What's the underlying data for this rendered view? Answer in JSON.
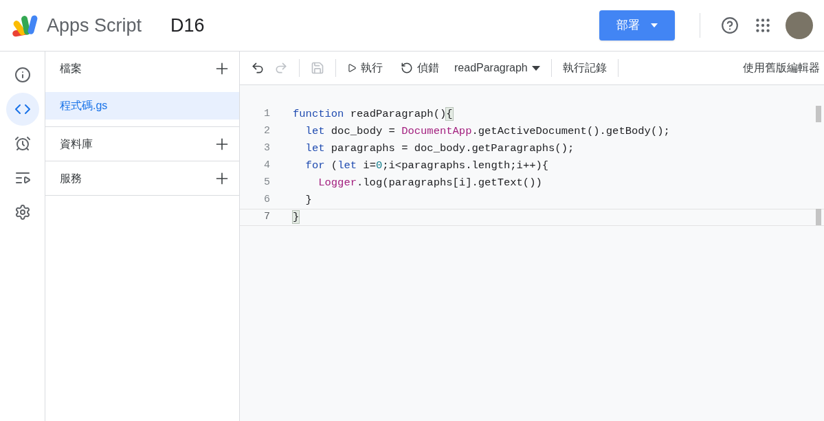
{
  "header": {
    "product": "Apps Script",
    "project": "D16",
    "deploy_button": "部署"
  },
  "rail": [
    {
      "kind": "info",
      "selected": false
    },
    {
      "kind": "code",
      "selected": true
    },
    {
      "kind": "triggers",
      "selected": false
    },
    {
      "kind": "executions",
      "selected": false
    },
    {
      "kind": "settings",
      "selected": false
    }
  ],
  "sections": [
    {
      "title": "檔案",
      "files": [
        {
          "name": "程式碼.gs",
          "selected": true
        }
      ]
    },
    {
      "title": "資料庫"
    },
    {
      "title": "服務"
    }
  ],
  "toolbar": {
    "undo_disabled": false,
    "redo_disabled": true,
    "save_disabled": true,
    "run": "執行",
    "debug": "偵錯",
    "function": "readParagraph",
    "log": "執行記錄",
    "old_editor": "使用舊版編輯器"
  },
  "code": [
    {
      "number": "1",
      "current": false,
      "tokens": [
        {
          "text": "function",
          "kind": "keyword"
        },
        {
          "text": " readParagraph()",
          "kind": "plain"
        },
        {
          "text": "{",
          "kind": "bracket"
        }
      ]
    },
    {
      "number": "2",
      "current": false,
      "tokens": [
        {
          "text": "  let",
          "kind": "keyword"
        },
        {
          "text": " doc_body = ",
          "kind": "plain"
        },
        {
          "text": "DocumentApp",
          "kind": "class"
        },
        {
          "text": ".getActiveDocument().getBody();",
          "kind": "plain"
        }
      ]
    },
    {
      "number": "3",
      "current": false,
      "tokens": [
        {
          "text": "  let",
          "kind": "keyword"
        },
        {
          "text": " paragraphs = doc_body.getParagraphs();",
          "kind": "plain"
        }
      ]
    },
    {
      "number": "4",
      "current": false,
      "tokens": [
        {
          "text": "  for",
          "kind": "keyword"
        },
        {
          "text": " (",
          "kind": "plain"
        },
        {
          "text": "let",
          "kind": "keyword"
        },
        {
          "text": " i=",
          "kind": "plain"
        },
        {
          "text": "0",
          "kind": "number"
        },
        {
          "text": ";i<paragraphs.length;i++){",
          "kind": "plain"
        }
      ]
    },
    {
      "number": "5",
      "current": false,
      "tokens": [
        {
          "text": "    Logger",
          "kind": "class"
        },
        {
          "text": ".log(paragraphs[i].getText())",
          "kind": "plain"
        }
      ]
    },
    {
      "number": "6",
      "current": false,
      "tokens": [
        {
          "text": "  }",
          "kind": "plain"
        }
      ]
    },
    {
      "number": "7",
      "current": true,
      "tokens": [
        {
          "text": "}",
          "kind": "bracket"
        }
      ]
    }
  ]
}
